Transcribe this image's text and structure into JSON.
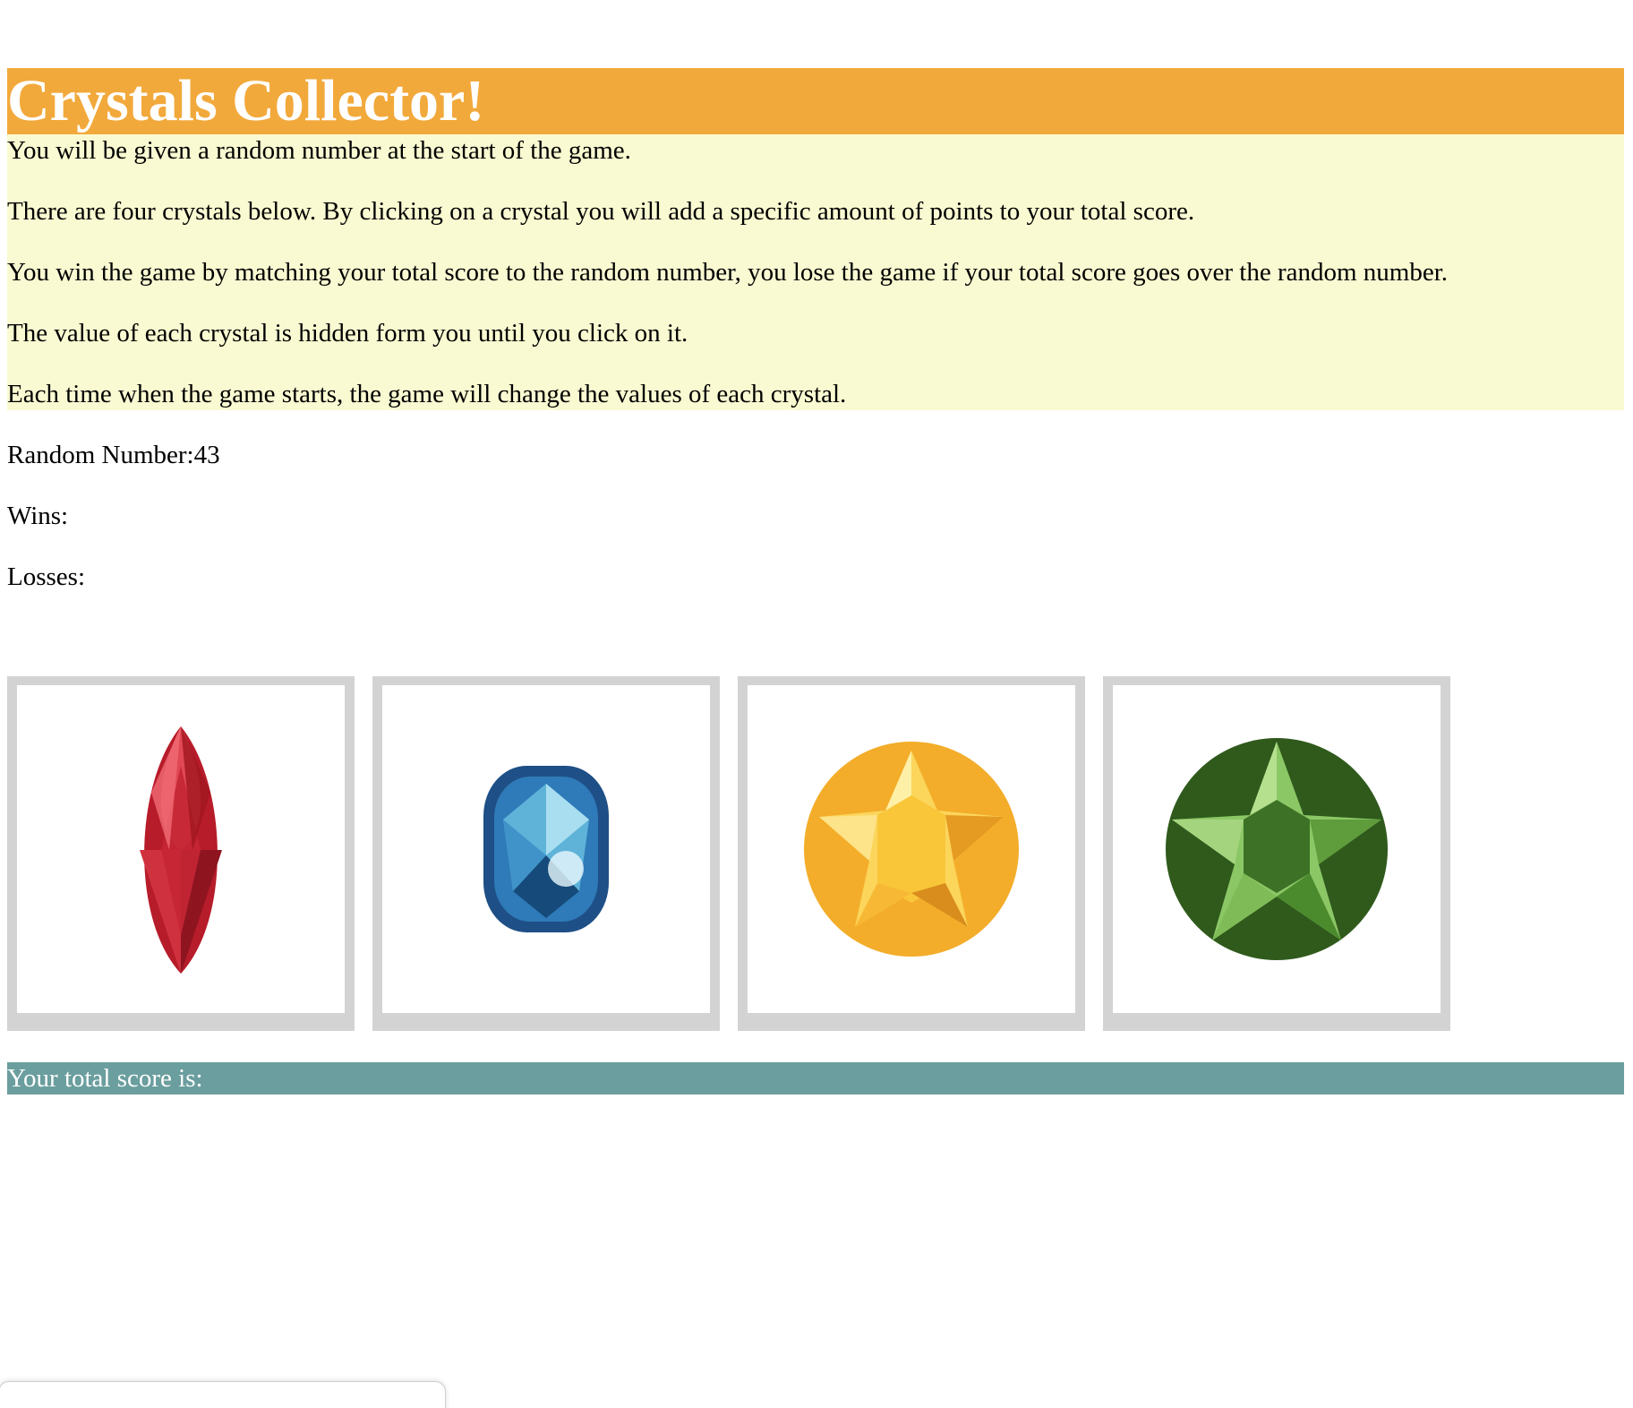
{
  "header": {
    "title": "Crystals Collector!"
  },
  "instructions": [
    "You will be given a random number at the start of the game.",
    "There are four crystals below. By clicking on a crystal you will add a specific amount of points to your total score.",
    "You win the game by matching your total score to the random number, you lose the game if your total score goes over the random number.",
    "The value of each crystal is hidden form you until you click on it.",
    "Each time when the game starts, the game will change the values of each crystal."
  ],
  "stats": {
    "random_number_label": "Random Number:",
    "random_number_value": "43",
    "wins_label": "Wins:",
    "losses_label": "Losses:"
  },
  "crystals": [
    {
      "name": "red marquise crystal",
      "color": "#c8202e"
    },
    {
      "name": "blue cushion crystal",
      "color": "#2a6fa8"
    },
    {
      "name": "yellow round crystal",
      "color": "#f5b82e"
    },
    {
      "name": "green round crystal",
      "color": "#4f8a2c"
    }
  ],
  "score": {
    "label": "Your total score is:"
  },
  "colors": {
    "header_bg": "#f2a93b",
    "instructions_bg": "#fafad2",
    "crystal_frame": "#d3d3d3",
    "score_bar_bg": "#6b9e9e"
  }
}
